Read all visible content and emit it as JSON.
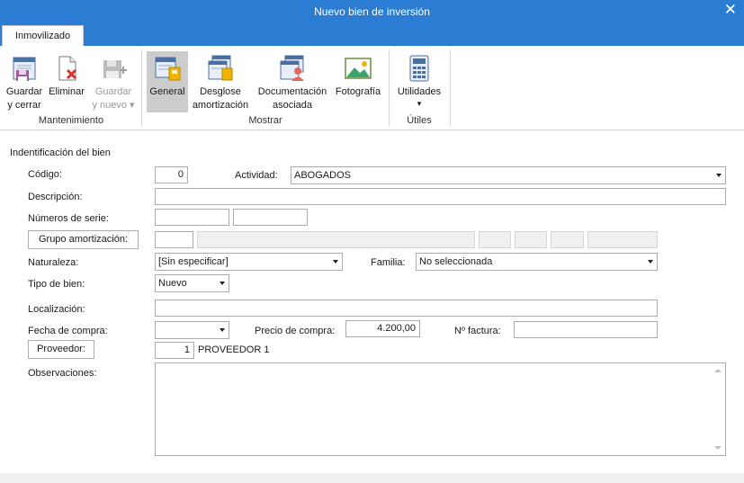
{
  "window": {
    "title": "Nuevo bien de inversión",
    "close_symbol": "✕"
  },
  "tabs": [
    {
      "label": "Inmovilizado",
      "active": true
    }
  ],
  "ribbon": {
    "groups": {
      "mantenimiento": "Mantenimiento",
      "mostrar": "Mostrar",
      "utiles": "Útiles"
    },
    "buttons": {
      "guardar_cerrar": {
        "line1": "Guardar",
        "line2": "y cerrar",
        "icon": "save-close-icon"
      },
      "eliminar": {
        "line1": "Eliminar",
        "icon": "delete-icon"
      },
      "guardar_nuevo": {
        "line1": "Guardar",
        "line2": "y nuevo ▾",
        "icon": "save-new-icon",
        "disabled": true
      },
      "general": {
        "line1": "General",
        "icon": "general-icon",
        "selected": true
      },
      "desglose": {
        "line1": "Desglose",
        "line2": "amortización",
        "icon": "breakdown-icon"
      },
      "documentacion": {
        "line1": "Documentación",
        "line2": "asociada",
        "icon": "documents-icon"
      },
      "fotografia": {
        "line1": "Fotografía",
        "icon": "photo-icon"
      },
      "utilidades": {
        "line1": "Utilidades",
        "line2": "▾",
        "icon": "calculator-icon"
      }
    }
  },
  "form": {
    "section_title": "Indentificación del bien",
    "codigo": {
      "label": "Código:",
      "value": "0"
    },
    "actividad": {
      "label": "Actividad:",
      "value": "ABOGADOS"
    },
    "descripcion": {
      "label": "Descripción:",
      "value": ""
    },
    "numeros_serie": {
      "label": "Números de serie:",
      "value1": "",
      "value2": ""
    },
    "grupo_amortizacion": {
      "button": "Grupo amortización:",
      "code": "",
      "name": ""
    },
    "naturaleza": {
      "label": "Naturaleza:",
      "value": "[Sin especificar]"
    },
    "familia": {
      "label": "Familia:",
      "value": "No seleccionada"
    },
    "tipo_bien": {
      "label": "Tipo de bien:",
      "value": "Nuevo"
    },
    "localizacion": {
      "label": "Localización:",
      "value": ""
    },
    "fecha_compra": {
      "label": "Fecha de compra:",
      "value": ""
    },
    "precio_compra": {
      "label": "Precio de compra:",
      "value": "4.200,00"
    },
    "n_factura": {
      "label": "Nº factura:",
      "value": ""
    },
    "proveedor": {
      "button": "Proveedor:",
      "code": "1",
      "name": "PROVEEDOR 1"
    },
    "observaciones": {
      "label": "Observaciones:",
      "value": ""
    }
  },
  "colors": {
    "titlebar": "#2b7cd3",
    "selected_button": "#cccccc",
    "border": "#ababab"
  }
}
